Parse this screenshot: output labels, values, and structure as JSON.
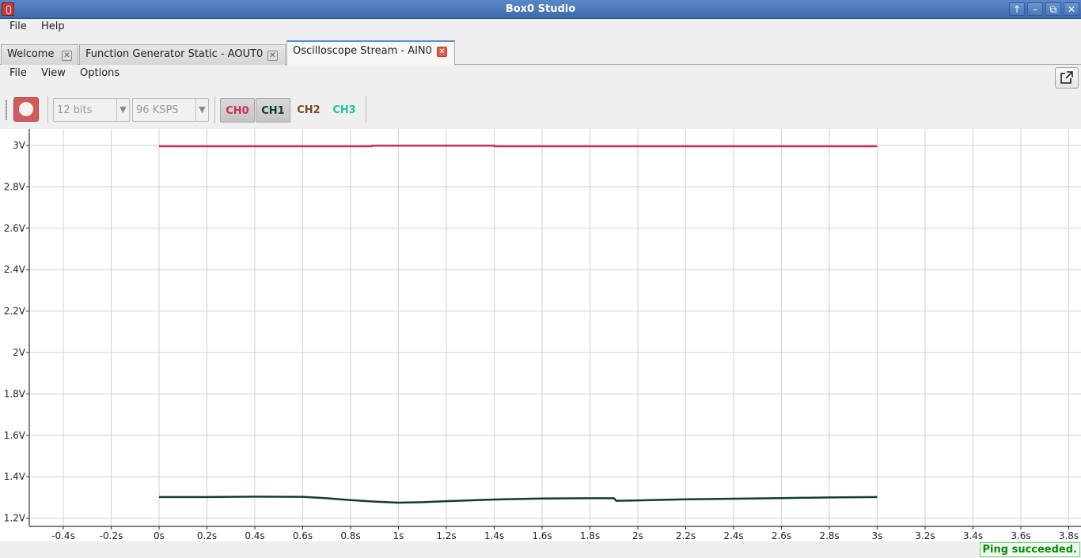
{
  "window": {
    "title": "Box0 Studio",
    "controls": [
      "↑",
      "–",
      "⧉",
      "✕"
    ]
  },
  "menubar": {
    "file": "File",
    "help": "Help"
  },
  "tabs": [
    {
      "label": "Welcome"
    },
    {
      "label": "Function Generator Static - AOUT0"
    },
    {
      "label": "Oscilloscope Stream - AIN0"
    }
  ],
  "submenu": {
    "file": "File",
    "view": "View",
    "options": "Options"
  },
  "toolbar": {
    "bits": "12 bits",
    "rate": "96 KSPS",
    "channels": [
      {
        "label": "CH0",
        "color": "#c8304f",
        "enabled": true
      },
      {
        "label": "CH1",
        "color": "#0c3f2c",
        "enabled": true
      },
      {
        "label": "CH2",
        "color": "#7a4a24",
        "enabled": false
      },
      {
        "label": "CH3",
        "color": "#1ec49a",
        "enabled": false
      }
    ]
  },
  "chart_data": {
    "type": "line",
    "grid": true,
    "xlim": [
      -0.5,
      3.85
    ],
    "ylim": [
      1.2,
      3.04
    ],
    "x_ticks": [
      -0.4,
      -0.2,
      0,
      0.2,
      0.4,
      0.6,
      0.8,
      1,
      1.2,
      1.4,
      1.6,
      1.8,
      2,
      2.2,
      2.4,
      2.6,
      2.8,
      3,
      3.2,
      3.4,
      3.6,
      3.8
    ],
    "x_tick_labels": [
      "-0.4s",
      "-0.2s",
      "0s",
      "0.2s",
      "0.4s",
      "0.6s",
      "0.8s",
      "1s",
      "1.2s",
      "1.4s",
      "1.6s",
      "1.8s",
      "2s",
      "2.2s",
      "2.4s",
      "2.6s",
      "2.8s",
      "3s",
      "3.2s",
      "3.4s",
      "3.6s",
      "3.8s"
    ],
    "y_ticks": [
      1.2,
      1.4,
      1.6,
      1.8,
      2,
      2.2,
      2.4,
      2.6,
      2.8,
      3
    ],
    "y_tick_labels": [
      "1.2V",
      "1.4V",
      "1.6V",
      "1.8V",
      "2V",
      "2.2V",
      "2.4V",
      "2.6V",
      "2.8V",
      "3V"
    ],
    "series": [
      {
        "channel": "CH0",
        "color": "#c8304f",
        "x": [
          0,
          0.89,
          0.89,
          1.4,
          1.4,
          3
        ],
        "y": [
          2.996,
          2.996,
          2.999,
          2.999,
          2.996,
          2.996
        ]
      },
      {
        "channel": "CH1",
        "color": "#0c3f2c",
        "x": [
          0,
          0.2,
          0.4,
          0.6,
          0.7,
          0.8,
          0.9,
          1.0,
          1.1,
          1.2,
          1.4,
          1.6,
          1.8,
          1.9,
          1.91,
          2.0,
          2.2,
          2.4,
          2.6,
          2.8,
          3.0
        ],
        "y": [
          1.302,
          1.302,
          1.304,
          1.303,
          1.296,
          1.287,
          1.28,
          1.275,
          1.277,
          1.282,
          1.29,
          1.295,
          1.296,
          1.296,
          1.284,
          1.286,
          1.291,
          1.294,
          1.297,
          1.3,
          1.302
        ]
      }
    ]
  },
  "status": {
    "text": "Ping succeeded."
  }
}
